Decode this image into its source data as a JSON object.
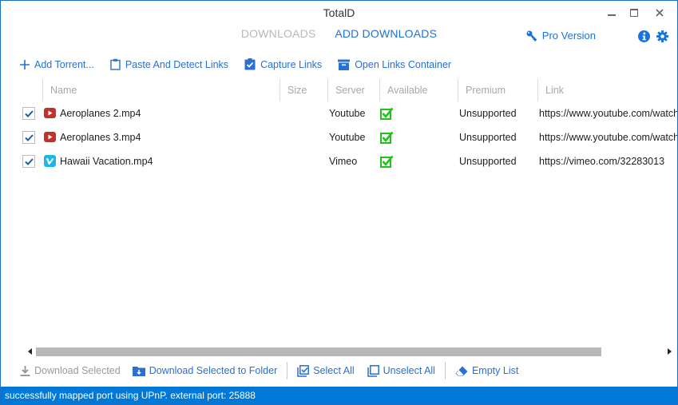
{
  "window": {
    "title": "TotalD",
    "controls": {
      "minimize": "minimize-icon",
      "maximize": "maximize-icon",
      "close": "close-icon"
    }
  },
  "tabs": [
    {
      "label": "DOWNLOADS",
      "active": false
    },
    {
      "label": "ADD DOWNLOADS",
      "active": true
    }
  ],
  "header_right": {
    "pro_label": "Pro Version",
    "icons": [
      "key-icon",
      "info-icon",
      "gear-icon"
    ]
  },
  "toolbar": {
    "add_torrent": "Add Torrent...",
    "paste_detect": "Paste And Detect Links",
    "capture_links": "Capture Links",
    "open_container": "Open Links Container"
  },
  "table": {
    "columns": [
      "Name",
      "Size",
      "Server",
      "Available",
      "Premium",
      "Link"
    ],
    "rows": [
      {
        "checked": true,
        "icon": "youtube-icon",
        "name": "Aeroplanes 2.mp4",
        "size": "",
        "server": "Youtube",
        "available": true,
        "premium": "Unsupported",
        "link": "https://www.youtube.com/watch"
      },
      {
        "checked": true,
        "icon": "youtube-icon",
        "name": "Aeroplanes 3.mp4",
        "size": "",
        "server": "Youtube",
        "available": true,
        "premium": "Unsupported",
        "link": "https://www.youtube.com/watch"
      },
      {
        "checked": true,
        "icon": "vimeo-icon",
        "name": "Hawaii Vacation.mp4",
        "size": "",
        "server": "Vimeo",
        "available": true,
        "premium": "Unsupported",
        "link": "https://vimeo.com/32283013"
      }
    ]
  },
  "bottom_toolbar": {
    "download_selected": "Download Selected",
    "download_to_folder": "Download Selected to Folder",
    "select_all": "Select All",
    "unselect_all": "Unselect All",
    "empty_list": "Empty List"
  },
  "status": {
    "message": "successfully mapped port using UPnP. external port: 25888"
  },
  "colors": {
    "accent": "#1a73d9",
    "status_bar": "#0078d7",
    "available_check": "#22c21e",
    "youtube": "#c4302b",
    "vimeo": "#1ab7ea"
  }
}
